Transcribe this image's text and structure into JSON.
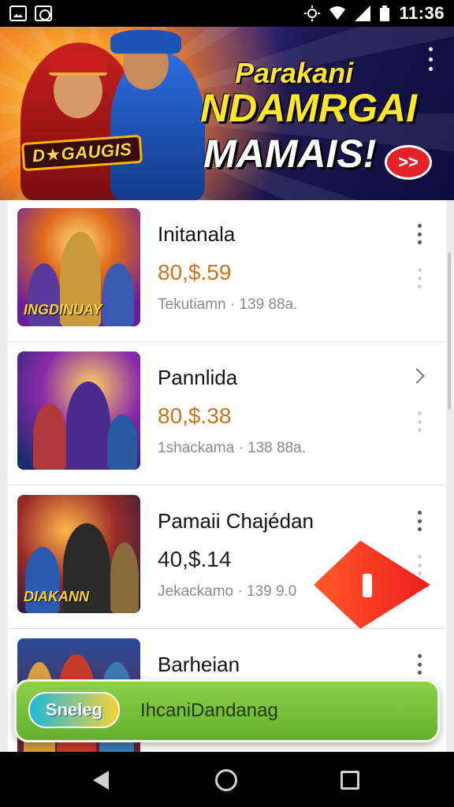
{
  "status_bar": {
    "time": "11:36"
  },
  "banner": {
    "logo_text": "D★GAUGIS",
    "headline_line1": "Parakani",
    "headline_line2": "NDAMRGAI",
    "headline_line3": "MAMAIS!",
    "cta_glyph": ">>"
  },
  "list": {
    "items": [
      {
        "title": "Initanala",
        "price": "80,$.59",
        "price_color": "#c8741a",
        "meta": "Tekutiamn · 139 88a.",
        "thumb_caption": "INGDINUAY",
        "action": "more"
      },
      {
        "title": "Pannlida",
        "price": "80,$.38",
        "price_color": "#c8741a",
        "meta": "1shackama · 138 88a.",
        "thumb_caption": "",
        "action": "chevron"
      },
      {
        "title": "Pamaii Chajédan",
        "price": "40,$.14",
        "price_color": "#222222",
        "meta": "Jekackamo · 139 9.0",
        "thumb_caption": "DIAKANN",
        "action": "more"
      },
      {
        "title": "Barheian",
        "price": "",
        "price_color": "#222222",
        "meta": "",
        "thumb_caption": "",
        "action": "more"
      }
    ]
  },
  "bottom_button": {
    "badge": "Sneleg",
    "label": "IhcaniDandanag"
  }
}
